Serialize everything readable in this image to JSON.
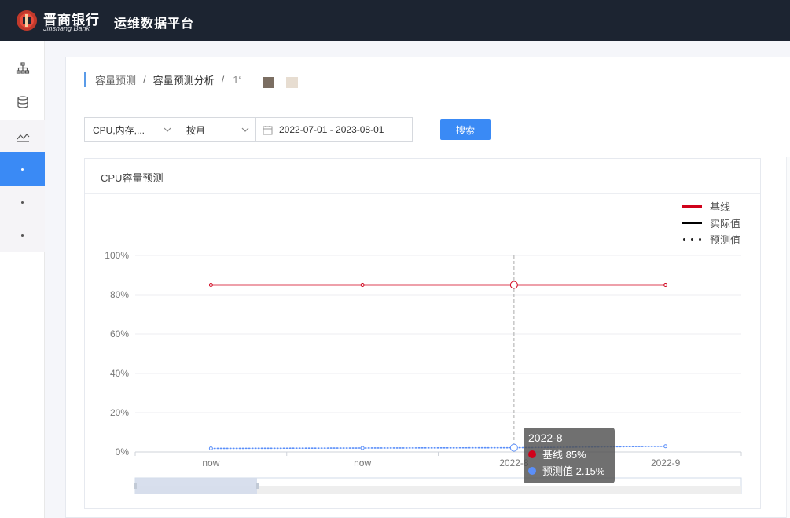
{
  "header": {
    "brand_cn": "晋商银行",
    "brand_en": "Jinshang Bank",
    "platform_title": "运维数据平台",
    "bg_color": "#1c2431"
  },
  "sidebar": {
    "items": [
      {
        "icon": "org-tree-icon"
      },
      {
        "icon": "database-icon"
      },
      {
        "icon": "line-chart-icon"
      },
      {
        "icon": "dot",
        "active": true
      },
      {
        "icon": "dot"
      },
      {
        "icon": "dot"
      }
    ],
    "accent": "#3a8af5"
  },
  "breadcrumb": {
    "items": [
      "容量预测",
      "容量预测分析",
      "1‘"
    ],
    "separator": "/"
  },
  "filters": {
    "metric": "CPU,内存,...",
    "granularity": "按月",
    "date_range": "2022-07-01 - 2023-08-01",
    "search_label": "搜索"
  },
  "chart_panel": {
    "title": "CPU容量预测"
  },
  "chart_data": {
    "type": "line",
    "title": "CPU容量预测",
    "categories": [
      "now",
      "now",
      "2022-8",
      "2022-9"
    ],
    "x_tick_labels": [
      "now",
      "now",
      "2022-8",
      "2022-9"
    ],
    "ylim": [
      0,
      100
    ],
    "y_ticks": [
      "0%",
      "20%",
      "40%",
      "60%",
      "80%",
      "100%"
    ],
    "grid": true,
    "legend_position": "top-right",
    "series": [
      {
        "name": "基线",
        "values": [
          85,
          85,
          85,
          85
        ],
        "color": "#d0021b",
        "style": "solid"
      },
      {
        "name": "实际值",
        "values": [],
        "color": "#000000",
        "style": "solid"
      },
      {
        "name": "预测值",
        "values": [
          1.8,
          2.0,
          2.15,
          2.9
        ],
        "color": "#5b8ff9",
        "style": "dotted"
      }
    ],
    "highlight_index": 2
  },
  "tooltip": {
    "title": "2022-8",
    "rows": [
      {
        "label": "基线 85%",
        "color": "#d0021b"
      },
      {
        "label": "预测值 2.15%",
        "color": "#5b8ff9"
      }
    ]
  }
}
